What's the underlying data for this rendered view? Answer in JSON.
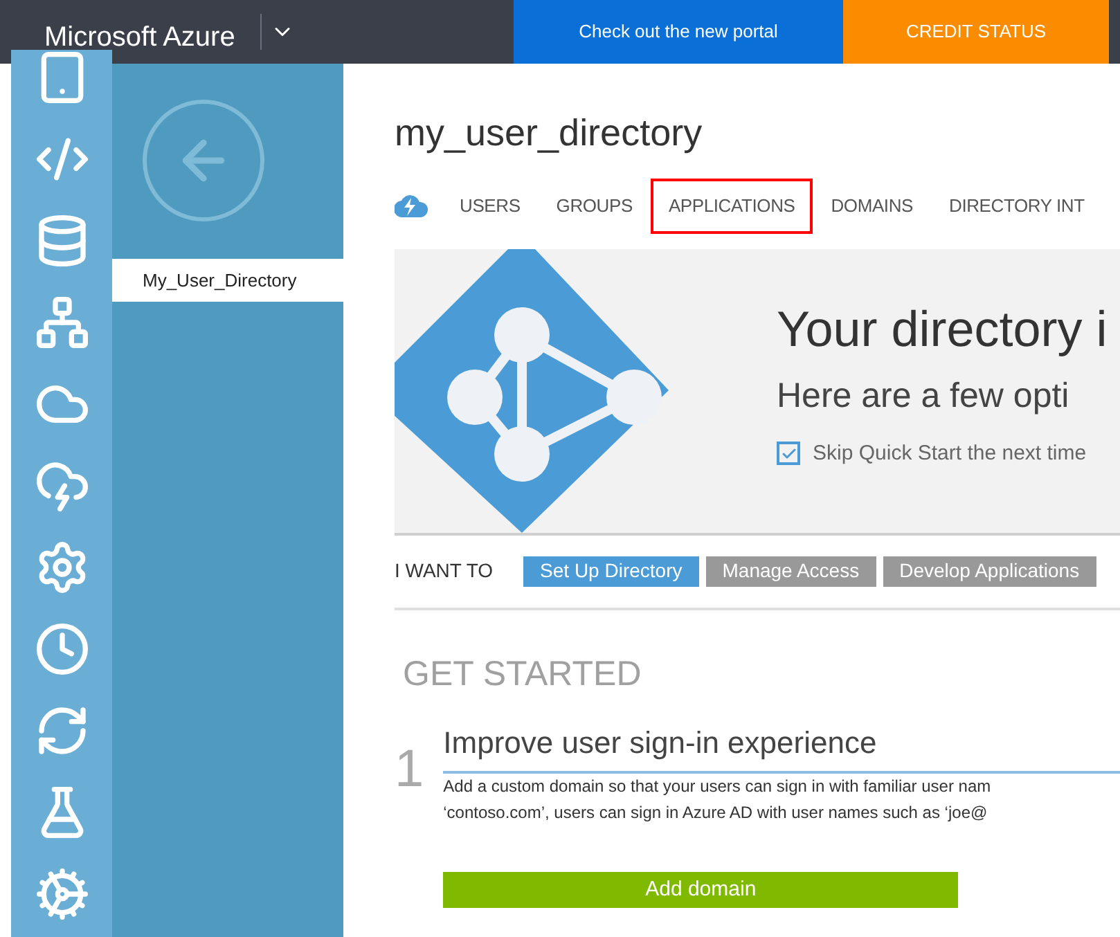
{
  "header": {
    "title": "Microsoft Azure",
    "promo_button": "Check out the new portal",
    "credit_button": "CREDIT STATUS"
  },
  "rail": {
    "items": [
      {
        "kind": "tablet"
      },
      {
        "kind": "code"
      },
      {
        "kind": "database"
      },
      {
        "kind": "network"
      },
      {
        "kind": "cloud"
      },
      {
        "kind": "lightning"
      },
      {
        "kind": "gear"
      },
      {
        "kind": "clock"
      },
      {
        "kind": "sync"
      },
      {
        "kind": "flask"
      },
      {
        "kind": "cog"
      }
    ]
  },
  "nav": {
    "items": [
      {
        "label": "My_User_Directory",
        "selected": true
      }
    ]
  },
  "page": {
    "title": "my_user_directory",
    "tabs": [
      {
        "label": "USERS",
        "highlighted": false
      },
      {
        "label": "GROUPS",
        "highlighted": false
      },
      {
        "label": "APPLICATIONS",
        "highlighted": true
      },
      {
        "label": "DOMAINS",
        "highlighted": false
      },
      {
        "label": "DIRECTORY INT",
        "highlighted": false
      }
    ],
    "banner": {
      "heading": "Your directory i",
      "subheading": "Here are a few opti",
      "skip": {
        "label": "Skip Quick Start the next time",
        "checked": true
      }
    },
    "i_want_to": {
      "label": "I WANT TO",
      "options": [
        {
          "label": "Set Up Directory",
          "selected": true
        },
        {
          "label": "Manage Access",
          "selected": false
        },
        {
          "label": "Develop Applications",
          "selected": false
        }
      ]
    },
    "get_started": {
      "heading": "GET STARTED",
      "step": {
        "number": "1",
        "title": "Improve user sign-in experience",
        "lines": [
          "Add a custom domain so that your users can sign in with familiar user nam",
          "‘contoso.com’, users can sign in Azure AD with user names such as ‘joe@"
        ],
        "button": "Add domain"
      }
    }
  }
}
